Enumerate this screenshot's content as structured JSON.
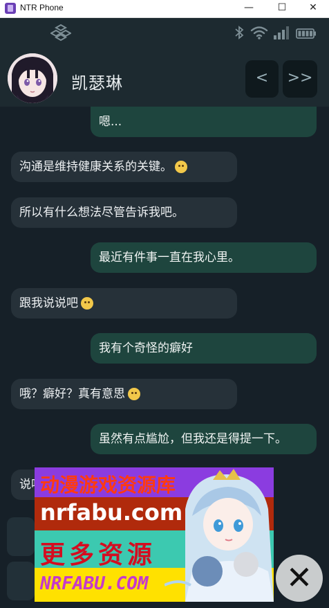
{
  "window": {
    "title": "NTR Phone",
    "minimize_glyph": "—",
    "maximize_glyph": "☐",
    "close_glyph": "✕"
  },
  "status_bar": {
    "icons": [
      "app-logo-icon",
      "bluetooth-icon",
      "wifi-icon",
      "signal-icon",
      "battery-icon"
    ]
  },
  "header": {
    "contact_name": "凯瑟琳",
    "prev_label": "<",
    "next_label": ">>"
  },
  "messages": [
    {
      "side": "out",
      "text": "嗯..."
    },
    {
      "side": "in",
      "text": "沟通是维持健康关系的关键。",
      "emoji": "hugging-face-emoji"
    },
    {
      "side": "in",
      "text": "所以有什么想法尽管告诉我吧。"
    },
    {
      "side": "out",
      "text": "最近有件事一直在我心里。"
    },
    {
      "side": "in",
      "text": "跟我说说吧",
      "emoji": "smile-emoji"
    },
    {
      "side": "out",
      "text": "我有个奇怪的癖好"
    },
    {
      "side": "in",
      "text": "哦？癖好？真有意思",
      "emoji": "winking-tongue-emoji"
    },
    {
      "side": "out",
      "text": "虽然有点尴尬，但我还是得提一下。"
    },
    {
      "side": "in",
      "text": "说吧"
    }
  ],
  "ad": {
    "line1": "动漫游戏资源库",
    "line2": "nrfabu.com",
    "line3": "更多资源",
    "line4": "NRFABU.COM",
    "close_glyph": "✕"
  },
  "colors": {
    "background": "#162028",
    "header": "#1d2a30",
    "bubble_out": "#1e453e",
    "bubble_in": "#263139",
    "ad_purple": "#8b3ce0",
    "ad_red": "#b02a0c",
    "ad_teal": "#3cc9b0",
    "ad_yellow": "#ffe100"
  }
}
